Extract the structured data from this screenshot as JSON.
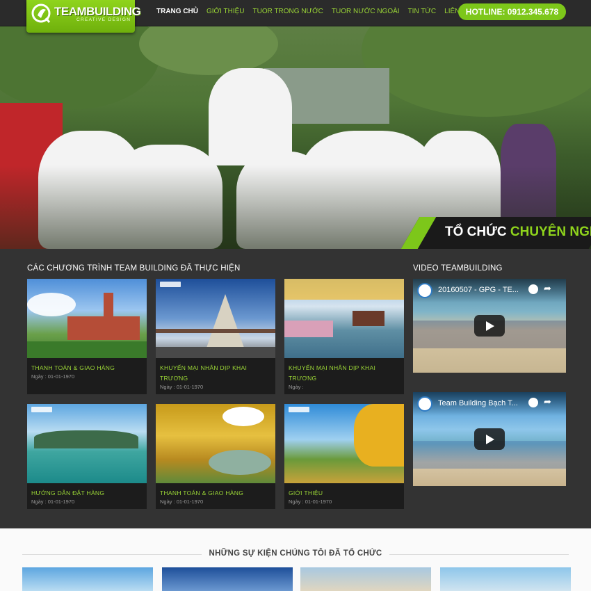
{
  "header": {
    "logo_text": "TEAMBUILDING",
    "logo_sub": "CREATIVE DESIGN",
    "nav": [
      {
        "label": "Trang chủ",
        "active": true
      },
      {
        "label": "Giới thiệu"
      },
      {
        "label": "Tuor trong nước"
      },
      {
        "label": "Tuor nước ngoài"
      },
      {
        "label": "Tin tức"
      },
      {
        "label": "Liên hệ"
      }
    ],
    "hotline": "HOTLINE: 0912.345.678"
  },
  "hero": {
    "caption_prefix": "TỔ CHỨC ",
    "caption_highlight": "CHUYÊN NGHI"
  },
  "programs": {
    "title": "CÁC CHƯƠNG TRÌNH TEAM BUILDING ĐÃ THỰC HIỆN",
    "items": [
      {
        "title": "THANH TOÁN & GIAO HÀNG",
        "date": "Ngày : 01-01-1970"
      },
      {
        "title": "KHUYẾN MẠI NHÂN DỊP KHAI TRƯƠNG",
        "date": "Ngày : 01-01-1970"
      },
      {
        "title": "KHUYẾN MẠI NHÂN DỊP KHAI TRƯƠNG",
        "date": "Ngày :"
      },
      {
        "title": "HƯỚNG DẪN ĐẶT HÀNG",
        "date": "Ngày : 01-01-1970"
      },
      {
        "title": "THANH TOÁN & GIAO HÀNG",
        "date": "Ngày : 01-01-1970"
      },
      {
        "title": "GIỚI THIỆU",
        "date": "Ngày : 01-01-1970"
      }
    ]
  },
  "videos": {
    "title": "VIDEO TEAMBUILDING",
    "items": [
      {
        "title": "20160507 - GPG - TE..."
      },
      {
        "title": "Team Building Bạch T..."
      }
    ]
  },
  "events": {
    "title": "NHỮNG SỰ KIỆN CHÚNG TÔI ĐÃ TỔ CHỨC"
  },
  "colors": {
    "accent": "#7dc71a",
    "accent_text": "#9bd636",
    "dark_bg": "#333333",
    "card_bg": "#1c1c1c"
  }
}
